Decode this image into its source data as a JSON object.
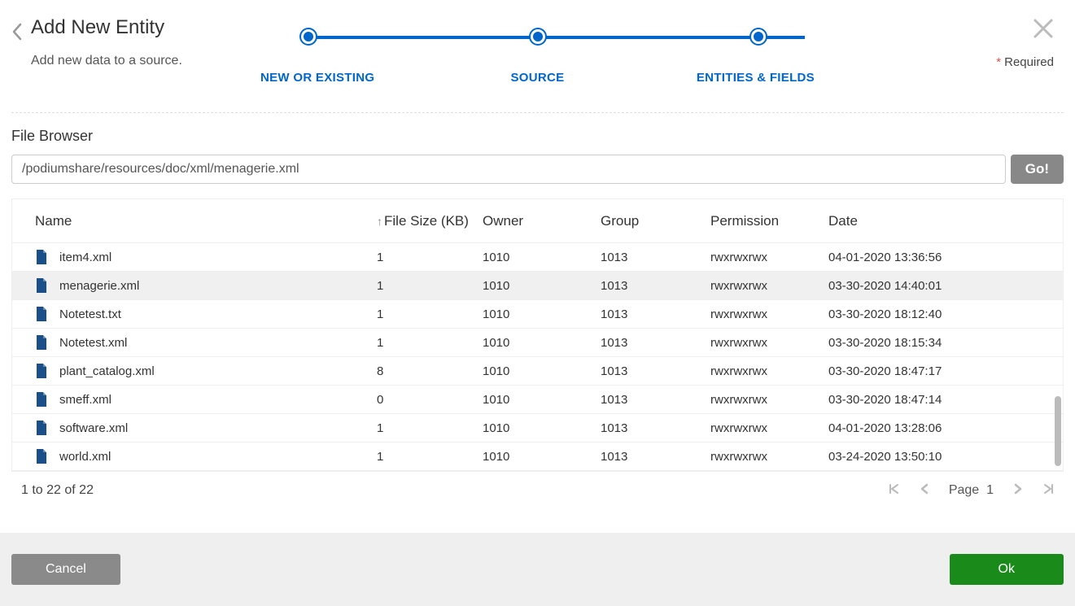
{
  "header": {
    "title": "Add New Entity",
    "subtitle": "Add new data to a source.",
    "required_label": "Required"
  },
  "steps": [
    {
      "label": "NEW OR EXISTING"
    },
    {
      "label": "SOURCE"
    },
    {
      "label": "ENTITIES & FIELDS"
    }
  ],
  "file_browser": {
    "title": "File Browser",
    "path": "/podiumshare/resources/doc/xml/menagerie.xml",
    "go_label": "Go!"
  },
  "columns": {
    "name": "Name",
    "size": "File Size (KB)",
    "owner": "Owner",
    "group": "Group",
    "permission": "Permission",
    "date": "Date"
  },
  "rows": [
    {
      "name": "item4.xml",
      "size": "1",
      "owner": "1010",
      "group": "1013",
      "perm": "rwxrwxrwx",
      "date": "04-01-2020 13:36:56",
      "selected": false
    },
    {
      "name": "menagerie.xml",
      "size": "1",
      "owner": "1010",
      "group": "1013",
      "perm": "rwxrwxrwx",
      "date": "03-30-2020 14:40:01",
      "selected": true
    },
    {
      "name": "Notetest.txt",
      "size": "1",
      "owner": "1010",
      "group": "1013",
      "perm": "rwxrwxrwx",
      "date": "03-30-2020 18:12:40",
      "selected": false
    },
    {
      "name": "Notetest.xml",
      "size": "1",
      "owner": "1010",
      "group": "1013",
      "perm": "rwxrwxrwx",
      "date": "03-30-2020 18:15:34",
      "selected": false
    },
    {
      "name": "plant_catalog.xml",
      "size": "8",
      "owner": "1010",
      "group": "1013",
      "perm": "rwxrwxrwx",
      "date": "03-30-2020 18:47:17",
      "selected": false
    },
    {
      "name": "smeff.xml",
      "size": "0",
      "owner": "1010",
      "group": "1013",
      "perm": "rwxrwxrwx",
      "date": "03-30-2020 18:47:14",
      "selected": false
    },
    {
      "name": "software.xml",
      "size": "1",
      "owner": "1010",
      "group": "1013",
      "perm": "rwxrwxrwx",
      "date": "04-01-2020 13:28:06",
      "selected": false
    },
    {
      "name": "world.xml",
      "size": "1",
      "owner": "1010",
      "group": "1013",
      "perm": "rwxrwxrwx",
      "date": "03-24-2020 13:50:10",
      "selected": false
    }
  ],
  "pagination": {
    "summary": "1 to 22 of 22",
    "page_label": "Page",
    "page_number": "1"
  },
  "footer": {
    "cancel": "Cancel",
    "ok": "Ok"
  }
}
